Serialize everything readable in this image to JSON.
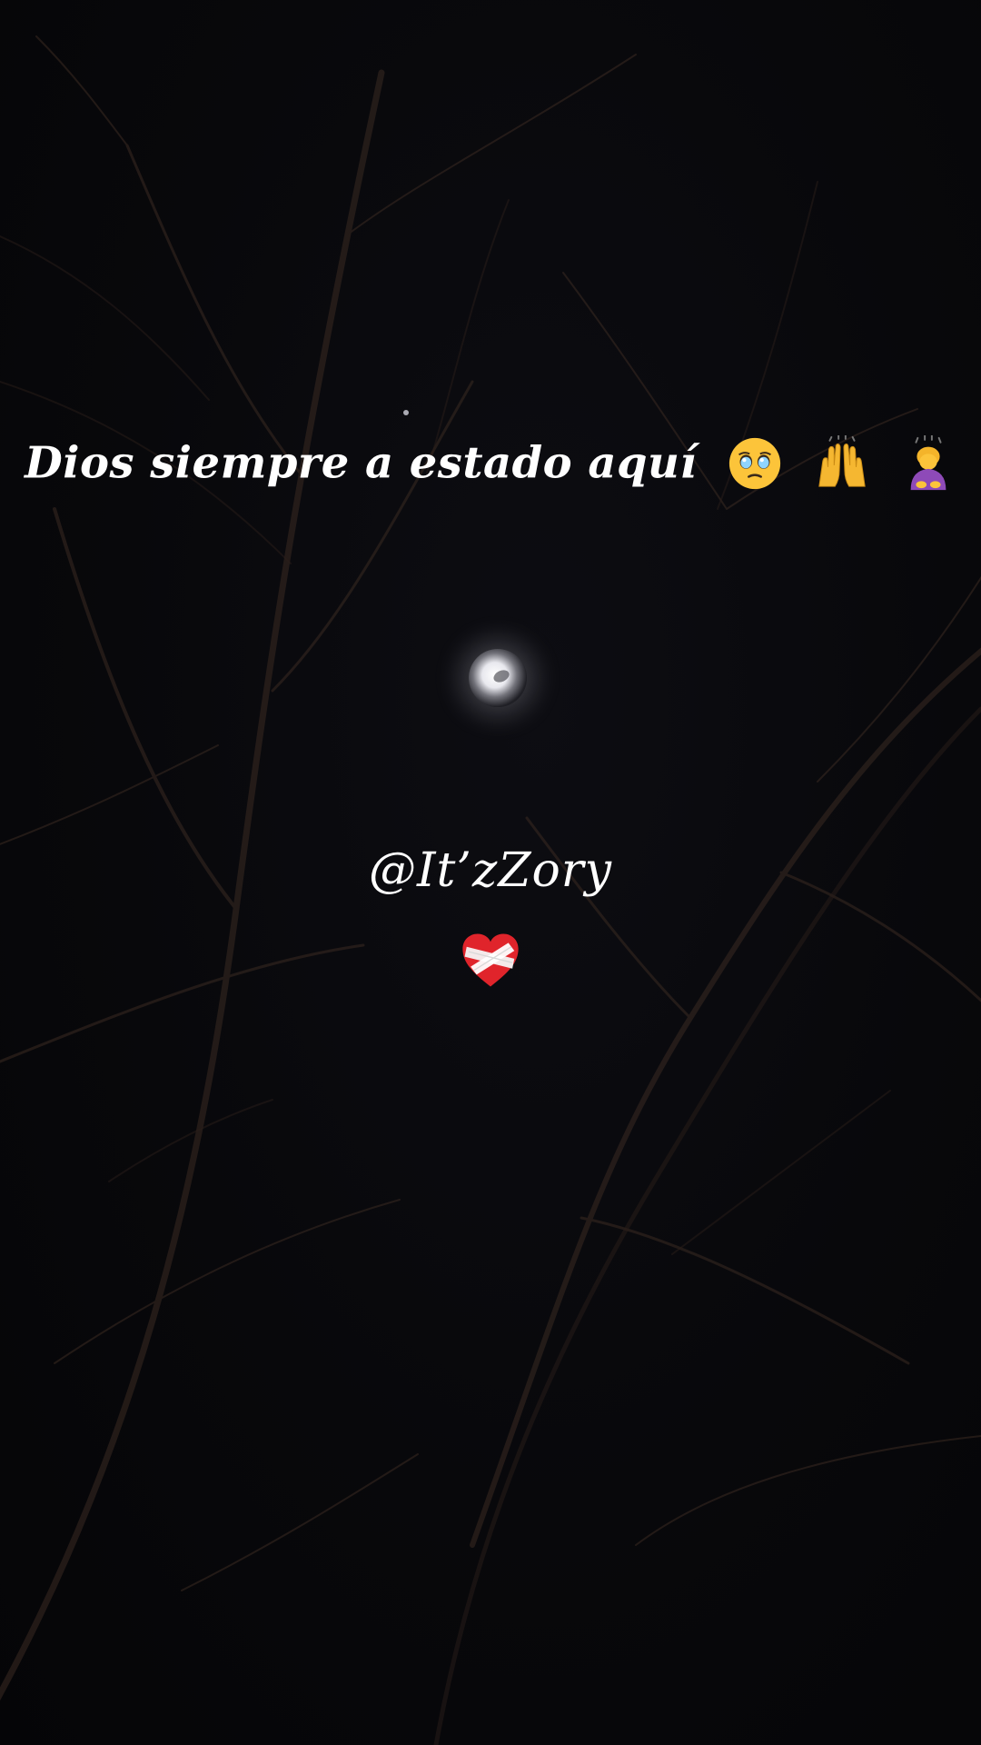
{
  "caption": {
    "text": "Dios siempre a estado aquí",
    "emojis": [
      "face-holding-back-tears-icon",
      "raising-hands-icon",
      "person-bowing-icon"
    ]
  },
  "handle": "@It’zZory",
  "heart_icon": "mending-heart-icon",
  "colors": {
    "text": "#ffffff",
    "background": "#07070a",
    "branches": "#3a2a22",
    "heart": "#e0242b"
  }
}
